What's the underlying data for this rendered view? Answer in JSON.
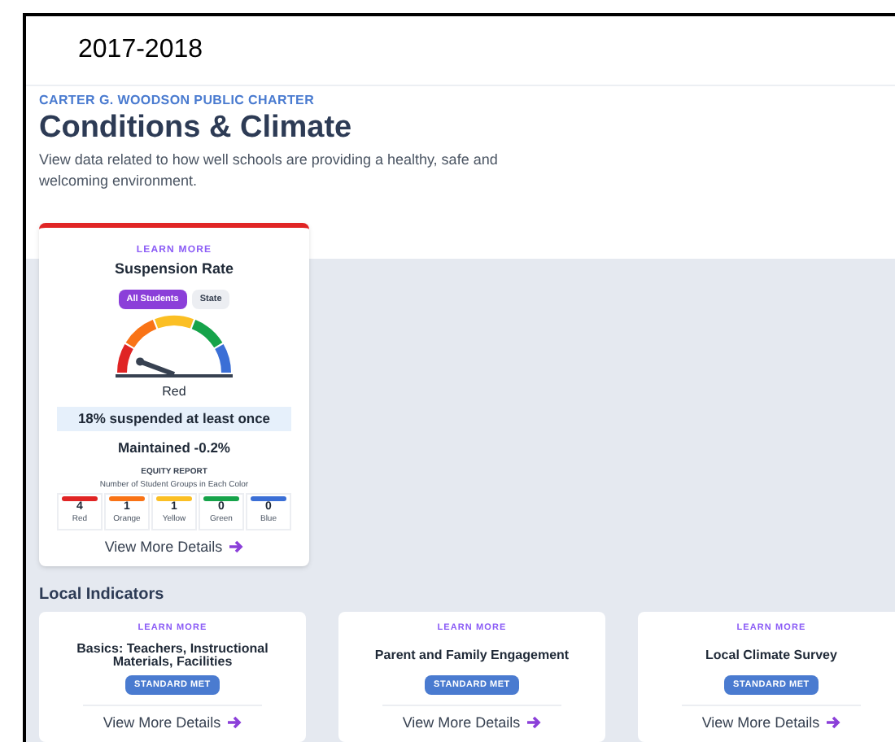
{
  "year": "2017-2018",
  "school": "CARTER G. WOODSON PUBLIC CHARTER",
  "title": "Conditions & Climate",
  "description": "View data related to how well schools are providing a healthy, safe and welcoming environment.",
  "suspension_card": {
    "learn_more": "LEARN MORE",
    "title": "Suspension Rate",
    "toggles": [
      {
        "label": "All Students",
        "selected": true
      },
      {
        "label": "State",
        "selected": false
      }
    ],
    "status": "Red",
    "highlight": "18% suspended at least once",
    "change": "Maintained -0.2%",
    "equity_title": "EQUITY REPORT",
    "equity_subtitle": "Number of Student Groups in Each Color",
    "equity": [
      {
        "count": "4",
        "label": "Red",
        "color": "#e02424"
      },
      {
        "count": "1",
        "label": "Orange",
        "color": "#f97316"
      },
      {
        "count": "1",
        "label": "Yellow",
        "color": "#fbbf24"
      },
      {
        "count": "0",
        "label": "Green",
        "color": "#16a34a"
      },
      {
        "count": "0",
        "label": "Blue",
        "color": "#3b6fd6"
      }
    ],
    "details_link": "View More Details"
  },
  "local_indicators": {
    "heading": "Local Indicators",
    "cards": [
      {
        "learn_more": "LEARN MORE",
        "title": "Basics: Teachers, Instructional Materials, Facilities",
        "badge": "STANDARD MET",
        "details_link": "View More Details"
      },
      {
        "learn_more": "LEARN MORE",
        "title": "Parent and Family Engagement",
        "badge": "STANDARD MET",
        "details_link": "View More Details"
      },
      {
        "learn_more": "LEARN MORE",
        "title": "Local Climate Survey",
        "badge": "STANDARD MET",
        "details_link": "View More Details"
      }
    ]
  }
}
